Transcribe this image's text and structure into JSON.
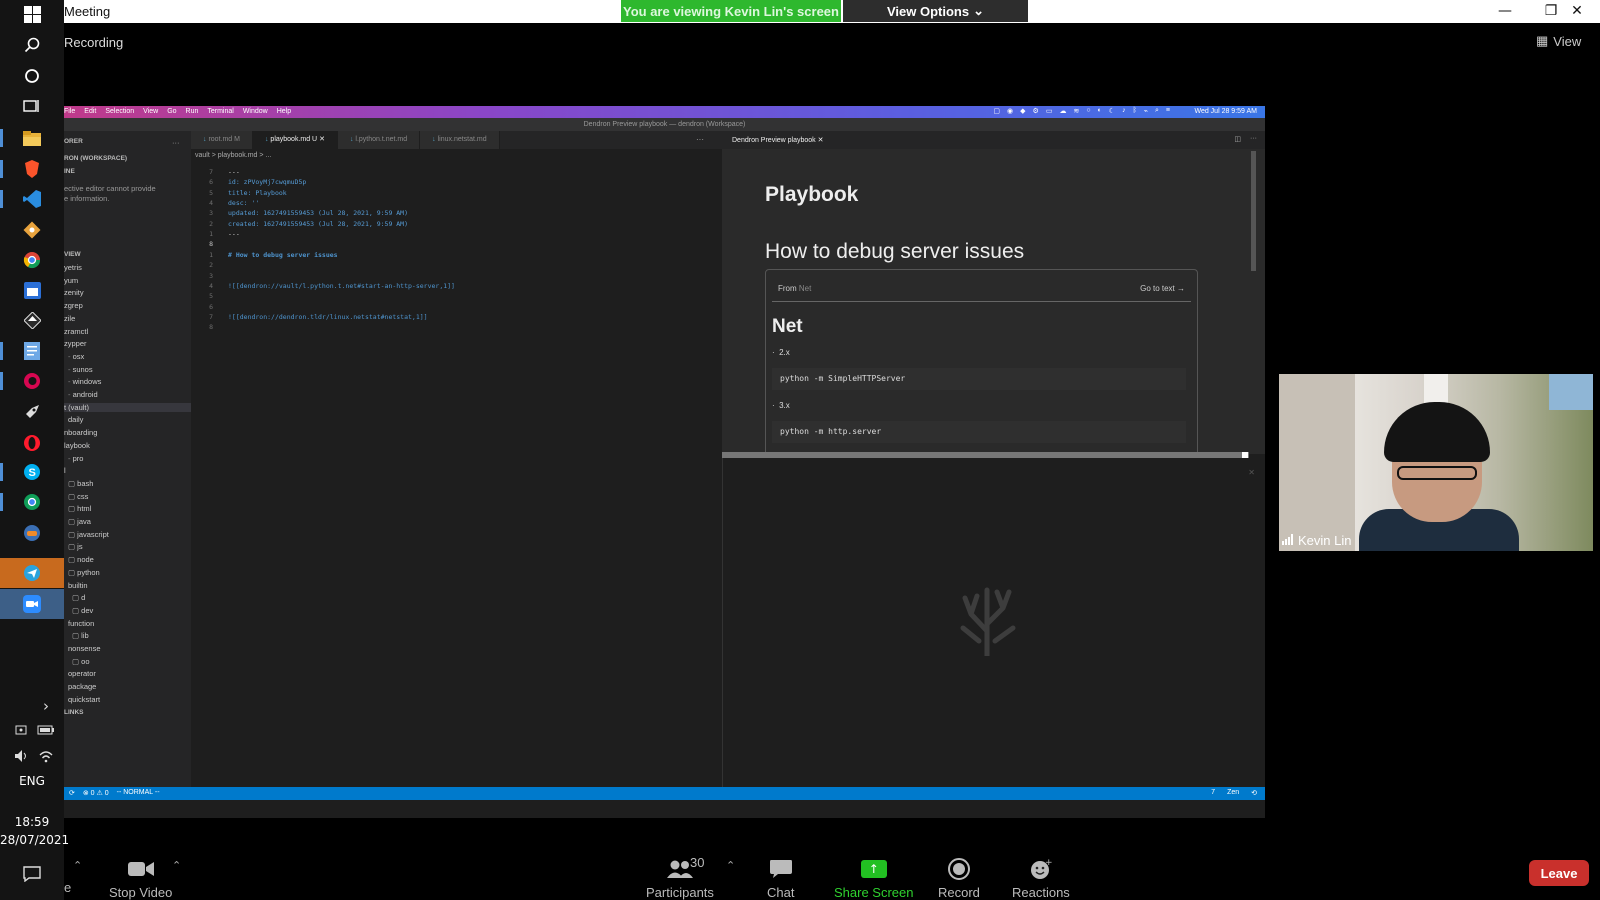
{
  "window": {
    "title": "Meeting",
    "recording": "Recording",
    "viewing_banner": "You are viewing Kevin Lin's screen",
    "view_options": "View Options",
    "view_button": "View"
  },
  "taskbar": {
    "language": "ENG",
    "time": "18:59",
    "date": "28/07/2021"
  },
  "shared_screen": {
    "mac_menu": [
      "File",
      "Edit",
      "Selection",
      "View",
      "Go",
      "Run",
      "Terminal",
      "Window",
      "Help"
    ],
    "mac_date": "Wed Jul 28  9:59 AM",
    "vscode_title": "Dendron Preview playbook — dendron (Workspace)",
    "explorer": {
      "header": "ORER",
      "workspace": "RON (WORKSPACE)",
      "outline": "INE",
      "outline_msg_1": "ective editor cannot provide",
      "outline_msg_2": "e information.",
      "tree_header": "VIEW",
      "tree_items": [
        "yetris",
        "yum",
        "zenity",
        "zgrep",
        "zile",
        "zramctl",
        "zypper",
        "osx",
        "sunos",
        "windows",
        "android",
        "t (vault)",
        "daily",
        "nboarding",
        "laybook",
        "pro",
        "l",
        "bash",
        "css",
        "html",
        "java",
        "javascript",
        "js",
        "node",
        "python",
        "builtin",
        "d",
        "dev",
        "function",
        "lib",
        "nonsense",
        "oo",
        "operator",
        "package",
        "quickstart"
      ],
      "links_header": "LINKS"
    },
    "tabs": [
      {
        "label": "root.md  M"
      },
      {
        "label": "playbook.md  U"
      },
      {
        "label": "l.python.t.net.md"
      },
      {
        "label": "linux.netstat.md"
      }
    ],
    "breadcrumb": "vault  >  playbook.md  > ...",
    "code_lines": [
      {
        "n": "7",
        "t": "---"
      },
      {
        "n": "6",
        "t": "id: zPVoyMj7cwqmuD5p"
      },
      {
        "n": "5",
        "t": "title: Playbook"
      },
      {
        "n": "4",
        "t": "desc: ''"
      },
      {
        "n": "3",
        "t": "updated: 1627491559453 (Jul 28, 2021, 9:59 AM)"
      },
      {
        "n": "2",
        "t": "created: 1627491559453 (Jul 28, 2021, 9:59 AM)"
      },
      {
        "n": "1",
        "t": "---"
      },
      {
        "n": "8",
        "t": ""
      },
      {
        "n": "1",
        "t": "# How to debug server issues"
      },
      {
        "n": "2",
        "t": ""
      },
      {
        "n": "3",
        "t": ""
      },
      {
        "n": "4",
        "t": "![[dendron://vault/l.python.t.net#start-an-http-server,1]]"
      },
      {
        "n": "5",
        "t": ""
      },
      {
        "n": "6",
        "t": ""
      },
      {
        "n": "7",
        "t": "![[dendron://dendron.tldr/linux.netstat#netstat,1]]"
      },
      {
        "n": "8",
        "t": ""
      }
    ],
    "preview": {
      "tab_label": "Dendron Preview playbook",
      "h1": "Playbook",
      "h2": "How to debug server issues",
      "from_label": "From",
      "from_note": "Net",
      "goto": "Go to text →",
      "ref_title": "Net",
      "items": [
        {
          "bullet": "2.x",
          "code": "python -m SimpleHTTPServer"
        },
        {
          "bullet": "3.x",
          "code": "python -m http.server"
        }
      ]
    },
    "statusbar": {
      "errors": "⊗ 0 ⚠ 0",
      "mode": "-- NORMAL --",
      "line": "7",
      "zen": "Zen"
    }
  },
  "participant": {
    "name": "Kevin Lin"
  },
  "toolbar": {
    "stop_video": "Stop Video",
    "participants": "Participants",
    "participants_count": "30",
    "chat": "Chat",
    "share_screen": "Share Screen",
    "record": "Record",
    "reactions": "Reactions",
    "leave": "Leave"
  },
  "colors": {
    "banner_green": "#2eb82e",
    "leave_red": "#c9302c",
    "statusbar_blue": "#007acc"
  }
}
